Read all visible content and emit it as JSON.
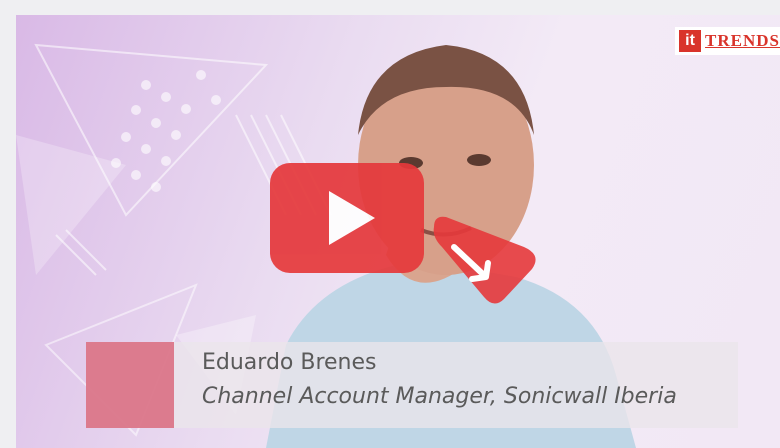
{
  "video": {
    "logo_mark": "it",
    "logo_text": "TRENDS",
    "play_button_icon": "play-icon",
    "cursor_icon": "cursor-arrow-icon",
    "accent_color": "#e5383b"
  },
  "lower_third": {
    "name": "Eduardo Brenes",
    "title": "Channel Account Manager, Sonicwall Iberia"
  }
}
